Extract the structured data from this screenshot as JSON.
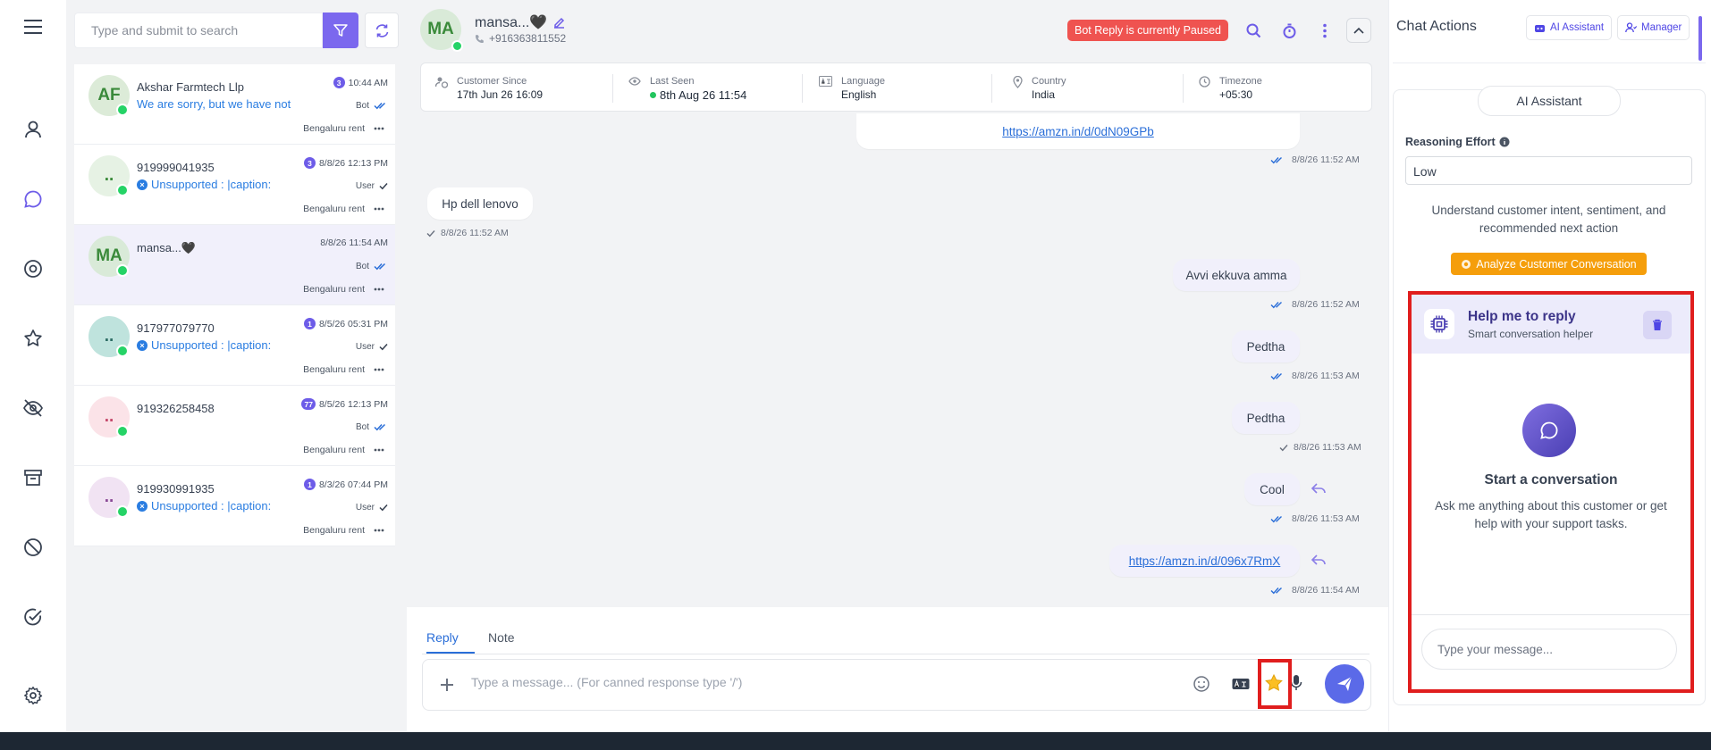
{
  "search": {
    "placeholder": "Type and submit to search"
  },
  "conversations": [
    {
      "initials": "AF",
      "name": "Akshar Farmtech Llp",
      "message": "We are sorry, but we have not",
      "unread": "3",
      "time": "10:44 AM",
      "sender": "Bot",
      "location": "Bengaluru rent",
      "avatar_bg": "#dcebd8",
      "avatar_fg": "#3a8a3a"
    },
    {
      "initials": "..",
      "name": "919999041935",
      "message": "Unsupported : |caption:",
      "unread": "3",
      "time": "8/8/26 12:13 PM",
      "sender": "User",
      "location": "Bengaluru rent",
      "avatar_bg": "#e6f2e4",
      "avatar_fg": "#3a8a3a"
    },
    {
      "initials": "MA",
      "name": "mansa...🖤",
      "message": "",
      "unread": "",
      "time": "8/8/26 11:54 AM",
      "sender": "Bot",
      "location": "Bengaluru rent",
      "avatar_bg": "#d9ead8",
      "avatar_fg": "#3a8a3a"
    },
    {
      "initials": "..",
      "name": "917977079770",
      "message": "Unsupported : |caption:",
      "unread": "1",
      "time": "8/5/26 05:31 PM",
      "sender": "User",
      "location": "Bengaluru rent",
      "avatar_bg": "#bfe3dd",
      "avatar_fg": "#2d6b63"
    },
    {
      "initials": "..",
      "name": "919326258458",
      "message": "",
      "unread": "77",
      "time": "8/5/26 12:13 PM",
      "sender": "Bot",
      "location": "Bengaluru rent",
      "avatar_bg": "#fbe3e8",
      "avatar_fg": "#c4486a"
    },
    {
      "initials": "..",
      "name": "919930991935",
      "message": "Unsupported : |caption:",
      "unread": "1",
      "time": "8/3/26 07:44 PM",
      "sender": "User",
      "location": "Bengaluru rent",
      "avatar_bg": "#f1e3f3",
      "avatar_fg": "#8a4a96"
    }
  ],
  "header": {
    "initials": "MA",
    "name": "mansa...🖤",
    "phone": "+916363811552",
    "paused_badge": "Bot Reply is currently Paused"
  },
  "info": {
    "customer_since_label": "Customer Since",
    "customer_since": "17th Jun 26 16:09",
    "last_seen_label": "Last Seen",
    "last_seen": "8th Aug 26 11:54",
    "language_label": "Language",
    "language": "English",
    "country_label": "Country",
    "country": "India",
    "timezone_label": "Timezone",
    "timezone": "+05:30"
  },
  "messages": [
    {
      "text": "https://amzn.in/d/0dN09GPb",
      "time": "8/8/26 11:52 AM"
    },
    {
      "text": "Hp dell lenovo",
      "time": "8/8/26 11:52 AM"
    },
    {
      "text": "Avvi ekkuva amma",
      "time": "8/8/26 11:52 AM"
    },
    {
      "text": "Pedtha",
      "time": "8/8/26 11:53 AM"
    },
    {
      "text": "Pedtha",
      "time": "8/8/26 11:53 AM"
    },
    {
      "text": "Cool",
      "time": "8/8/26 11:53 AM"
    },
    {
      "text": "https://amzn.in/d/096x7RmX",
      "time": "8/8/26 11:54 AM"
    }
  ],
  "composer": {
    "tab_reply": "Reply",
    "tab_note": "Note",
    "placeholder": "Type a message... (For canned response type '/')"
  },
  "right": {
    "title": "Chat Actions",
    "ai_button": "AI Assistant",
    "manager_button": "Manager",
    "ai_tab": "AI Assistant",
    "reasoning_label": "Reasoning Effort",
    "reasoning_value": "Low",
    "understand": "Understand customer intent, sentiment, and recommended next action",
    "analyze_button": "Analyze Customer Conversation",
    "help_title": "Help me to reply",
    "help_sub": "Smart conversation helper",
    "start_title": "Start a conversation",
    "start_desc": "Ask me anything about this customer or get help with your support tasks.",
    "input_placeholder": "Type your message..."
  },
  "colors": {
    "accent": "#7b68ee",
    "paused": "#ef5350",
    "analyze": "#f59e0b",
    "highlight": "#e01e1e",
    "link": "#2a6ed8"
  }
}
